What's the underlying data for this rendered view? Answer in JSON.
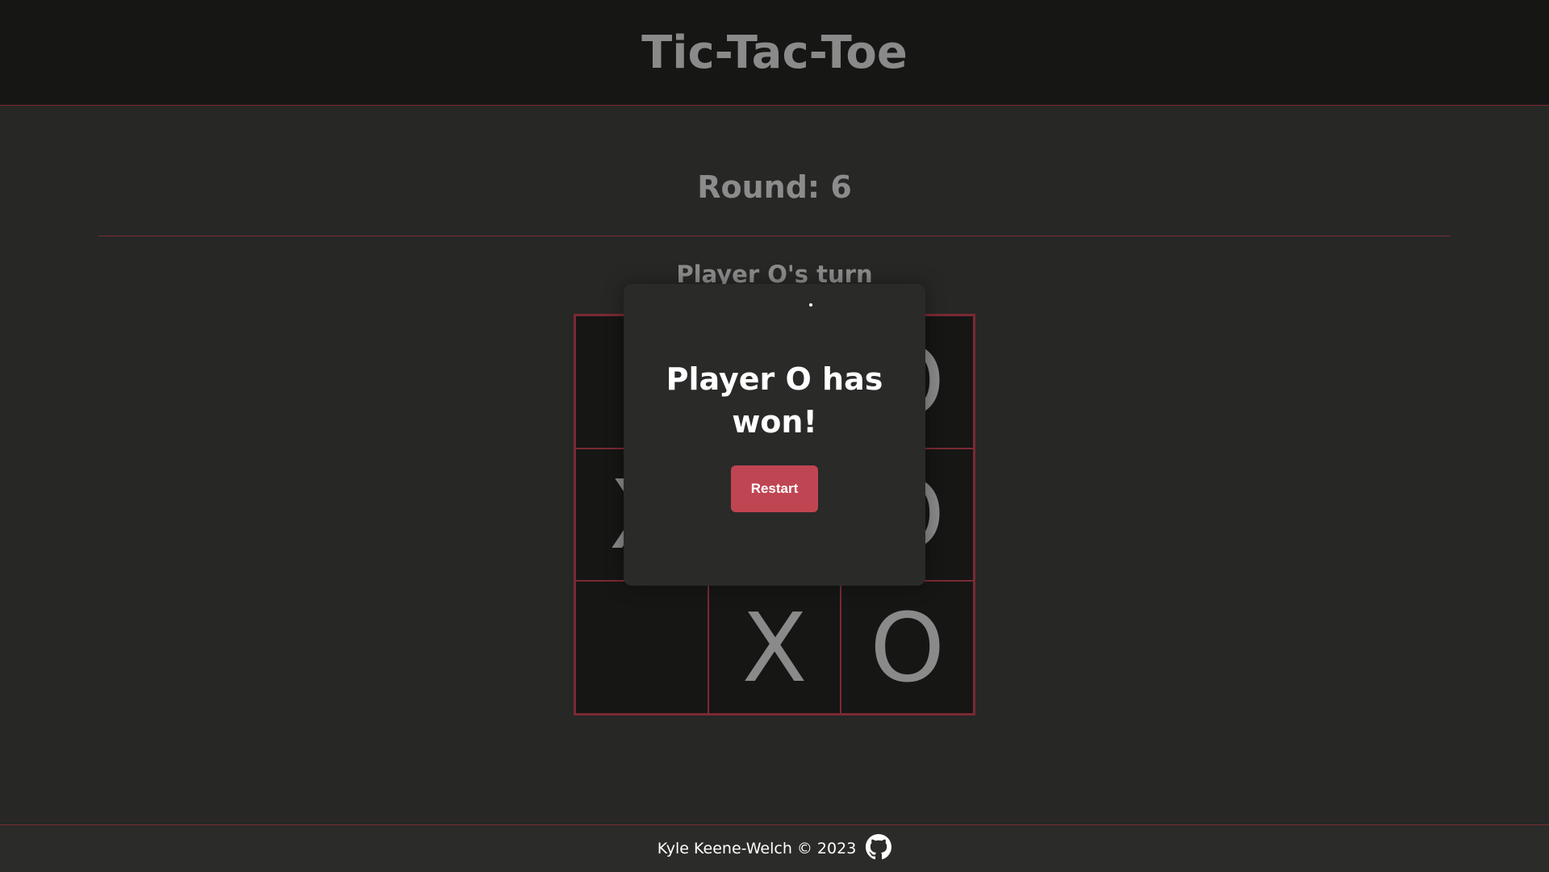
{
  "header": {
    "title": "Tic-Tac-Toe"
  },
  "game": {
    "round_text": "Round: 6",
    "turn_text": "Player O's turn",
    "board": [
      "",
      "",
      "O",
      "X",
      "",
      "O",
      "",
      "X",
      "O"
    ]
  },
  "modal": {
    "message": "Player O has won!",
    "restart_label": "Restart"
  },
  "footer": {
    "text": "Kyle Keene-Welch © 2023",
    "icon": "github-icon"
  },
  "colors": {
    "page_bg": "#272725",
    "header_bg": "#161615",
    "accent_border": "#7a2a33",
    "button": "#c04553",
    "muted_text": "#8a8a8a"
  }
}
